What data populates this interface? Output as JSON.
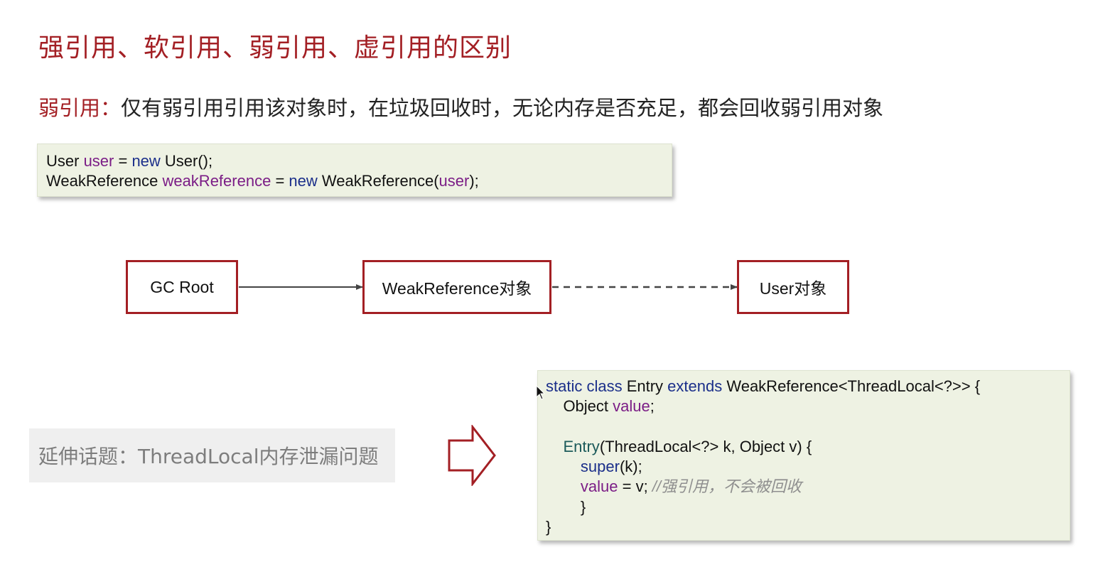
{
  "slide": {
    "title": "强引用、软引用、弱引用、虚引用的区别",
    "definition": {
      "label": "弱引用：",
      "text": "仅有弱引用引用该对象时，在垃圾回收时，无论内存是否充足，都会回收弱引用对象"
    },
    "code_sample": {
      "line1": {
        "t1": "User ",
        "t2": "user",
        "t3": " = ",
        "t4": "new",
        "t5": " User();"
      },
      "line2": {
        "t1": "WeakReference ",
        "t2": "weakReference",
        "t3": " = ",
        "t4": "new",
        "t5": " WeakReference(",
        "t6": "user",
        "t7": ");"
      }
    },
    "diagram": {
      "nodes": [
        "GC Root",
        "WeakReference对象",
        "User对象"
      ]
    },
    "extension_topic": "延伸话题：ThreadLocal内存泄漏问题",
    "code_entry": {
      "l1": {
        "a": "static class",
        "b": " Entry ",
        "c": "extends",
        "d": " WeakReference<ThreadLocal<?>> {"
      },
      "l2": {
        "a": "    Object ",
        "b": "value",
        "c": ";"
      },
      "l4": {
        "a": "    ",
        "b": "Entry",
        "c": "(ThreadLocal<?> k, Object v) {"
      },
      "l5": {
        "a": "        ",
        "b": "super",
        "c": "(k);"
      },
      "l6": {
        "a": "        ",
        "b": "value",
        "c": " = v; ",
        "d": "//强引用，不会被回收"
      },
      "l7": "        }",
      "l8": "}"
    }
  },
  "colors": {
    "accent": "#a31f24",
    "code_bg": "#eef2e3",
    "keyword_blue": "#1b2f8a",
    "field_purple": "#7b1d86",
    "comment_gray": "#8f8f8f"
  }
}
